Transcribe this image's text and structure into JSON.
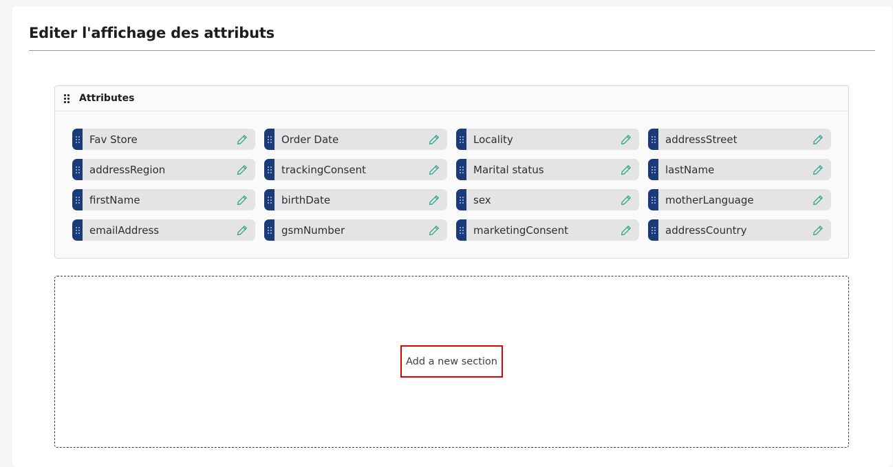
{
  "page": {
    "title": "Editer l'affichage des attributs"
  },
  "section": {
    "title": "Attributes",
    "icon": "drag-grip-icon",
    "attributes": [
      {
        "label": "Fav Store"
      },
      {
        "label": "Order Date"
      },
      {
        "label": "Locality"
      },
      {
        "label": "addressStreet"
      },
      {
        "label": "addressRegion"
      },
      {
        "label": "trackingConsent"
      },
      {
        "label": "Marital status"
      },
      {
        "label": "lastName"
      },
      {
        "label": "firstName"
      },
      {
        "label": "birthDate"
      },
      {
        "label": "sex"
      },
      {
        "label": "motherLanguage"
      },
      {
        "label": "emailAddress"
      },
      {
        "label": "gsmNumber"
      },
      {
        "label": "marketingConsent"
      },
      {
        "label": "addressCountry"
      }
    ],
    "edit_icon": "pencil-icon"
  },
  "drop_zone": {
    "add_label": "Add a new section"
  },
  "colors": {
    "handle": "#1b3a7a",
    "edit_icon": "#2aa58c",
    "highlight": "#e00000",
    "chip_bg": "#e4e4e4"
  }
}
